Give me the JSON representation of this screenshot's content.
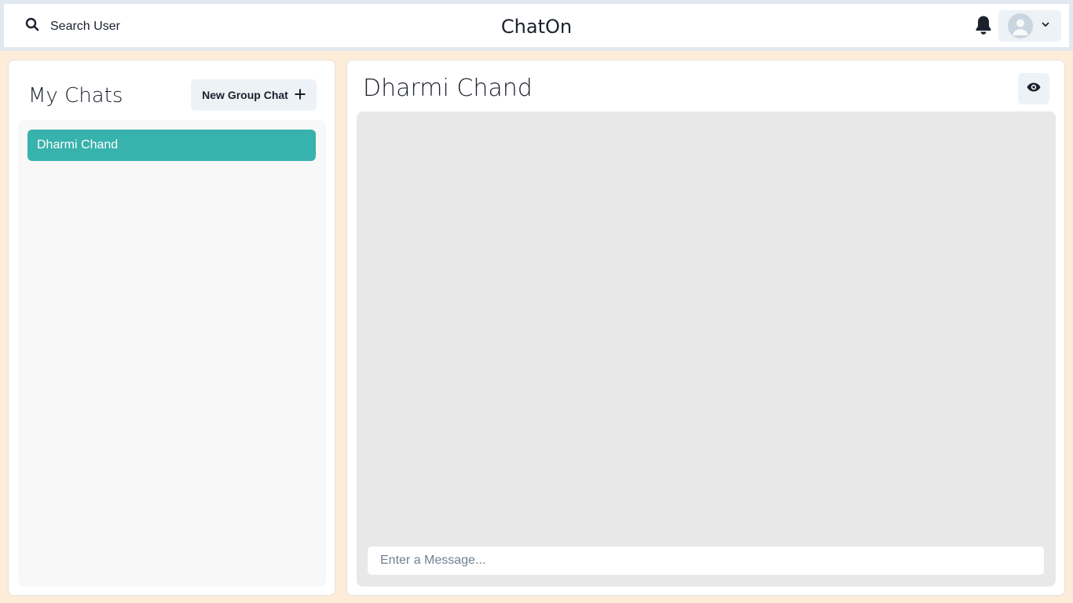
{
  "header": {
    "search_label": "Search User",
    "app_title": "ChatOn",
    "icons": {
      "search": "search-icon",
      "bell": "bell-icon",
      "avatar": "avatar",
      "chevron": "chevron-down-icon"
    }
  },
  "sidebar": {
    "title": "My Chats",
    "new_group_label": "New Group Chat",
    "chats": [
      {
        "name": "Dharmi Chand",
        "selected": true
      }
    ]
  },
  "chat": {
    "title": "Dharmi Chand",
    "input_placeholder": "Enter a Message...",
    "input_value": ""
  },
  "colors": {
    "background": "#fcecd8",
    "accent": "#38b2ac",
    "button_bg": "#edf2f7",
    "messages_bg": "#e8e8e8"
  }
}
